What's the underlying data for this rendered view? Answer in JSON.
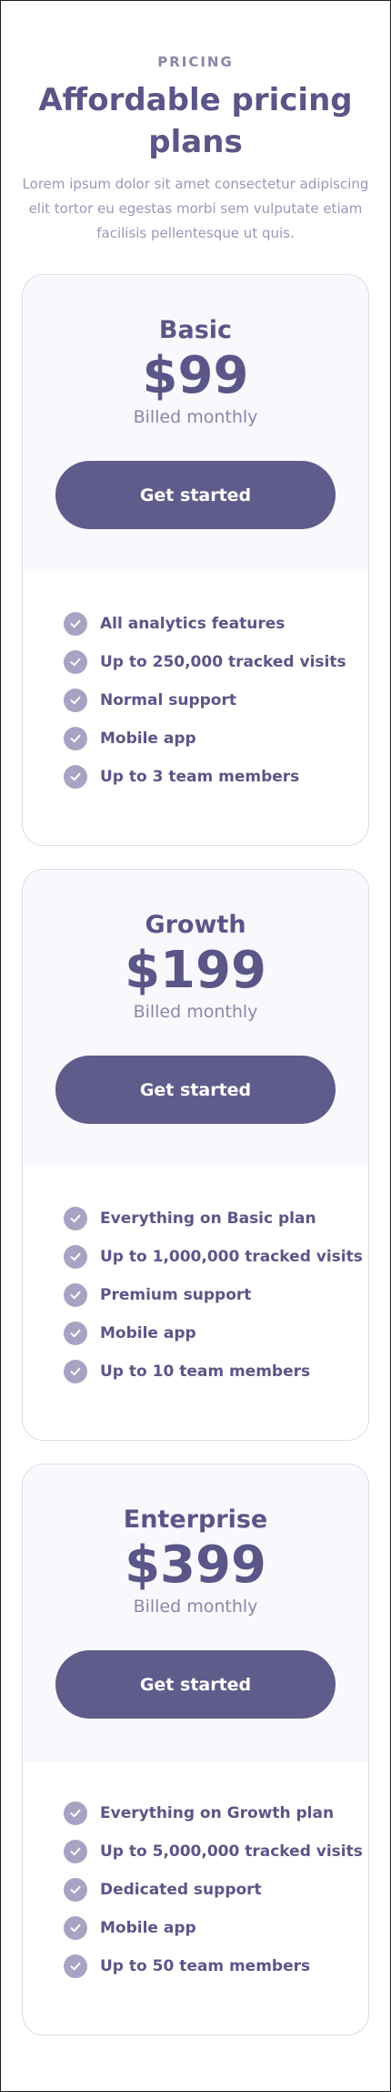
{
  "header": {
    "eyebrow": "PRICING",
    "title": "Affordable pricing plans",
    "subtitle": "Lorem ipsum dolor sit amet consectetur adipiscing elit tortor eu egestas morbi sem vulputate etiam facilisis pellentesque ut quis."
  },
  "colors": {
    "primary": "#5f5b8a",
    "card_top_bg": "#f8f8fd",
    "check_bg": "#a6a4c2",
    "text": "#5b5688",
    "muted": "#9a98b8"
  },
  "plans": [
    {
      "name": "Basic",
      "price": "$99",
      "billing": "Billed monthly",
      "cta": "Get started",
      "features": [
        "All analytics features",
        "Up to 250,000 tracked visits",
        "Normal support",
        "Mobile app",
        "Up to 3 team members"
      ]
    },
    {
      "name": "Growth",
      "price": "$199",
      "billing": "Billed monthly",
      "cta": "Get started",
      "features": [
        "Everything on Basic plan",
        "Up to 1,000,000 tracked visits",
        "Premium support",
        "Mobile app",
        "Up to 10 team members"
      ]
    },
    {
      "name": "Enterprise",
      "price": "$399",
      "billing": "Billed monthly",
      "cta": "Get started",
      "features": [
        "Everything on Growth plan",
        "Up to 5,000,000 tracked visits",
        "Dedicated support",
        "Mobile app",
        "Up to 50 team members"
      ]
    }
  ]
}
